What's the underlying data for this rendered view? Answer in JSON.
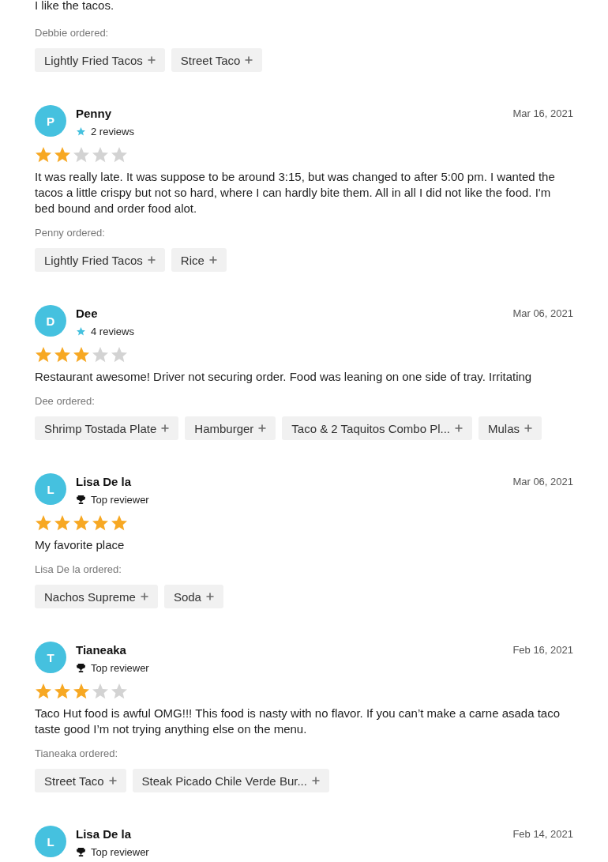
{
  "partial_review": {
    "text": "I like the tacos.",
    "ordered_label": "Debbie ordered:",
    "items": [
      "Lightly Fried Tacos",
      "Street Taco"
    ]
  },
  "reviews": [
    {
      "initial": "P",
      "name": "Penny",
      "badge": {
        "kind": "reviews",
        "label": "2 reviews"
      },
      "date": "Mar 16, 2021",
      "stars": 2,
      "text": "It was really late. It was suppose to be around 3:15, but was changed to after 5:00 pm. I wanted the tacos a little crispy but not so hard, where I can hardly bite them. All in all I did not like the food. I'm bed bound and order food alot.",
      "ordered_label": "Penny ordered:",
      "items": [
        "Lightly Fried Tacos",
        "Rice"
      ]
    },
    {
      "initial": "D",
      "name": "Dee",
      "badge": {
        "kind": "reviews",
        "label": "4 reviews"
      },
      "date": "Mar 06, 2021",
      "stars": 3,
      "text": "Restaurant awesome! Driver not securing order. Food was leaning on one side of tray. Irritating",
      "ordered_label": "Dee ordered:",
      "items": [
        "Shrimp Tostada Plate",
        "Hamburger",
        "Taco & 2 Taquitos Combo Pl...",
        "Mulas"
      ]
    },
    {
      "initial": "L",
      "name": "Lisa De la",
      "badge": {
        "kind": "top",
        "label": "Top reviewer"
      },
      "date": "Mar 06, 2021",
      "stars": 5,
      "text": "My favorite place",
      "ordered_label": "Lisa De la ordered:",
      "items": [
        "Nachos Supreme",
        "Soda"
      ]
    },
    {
      "initial": "T",
      "name": "Tianeaka",
      "badge": {
        "kind": "top",
        "label": "Top reviewer"
      },
      "date": "Feb 16, 2021",
      "stars": 3,
      "text": "Taco Hut food is awful OMG!!! This food is nasty with no flavor. If you can’t make a carne asada taco taste good I’m not trying anything else on the menu.",
      "ordered_label": "Tianeaka ordered:",
      "items": [
        "Street Taco",
        "Steak Picado Chile Verde Bur..."
      ]
    },
    {
      "initial": "L",
      "name": "Lisa De la",
      "badge": {
        "kind": "top",
        "label": "Top reviewer"
      },
      "date": "Feb 14, 2021"
    }
  ]
}
